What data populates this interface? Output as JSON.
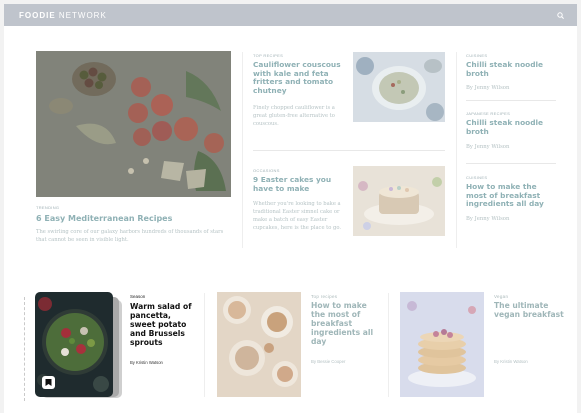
{
  "header": {
    "brand_bold": "FOODIE",
    "brand_light": " NETWORK",
    "search_icon": "search-icon"
  },
  "featured": {
    "kicker": "TRENDING",
    "title": "6 Easy Mediterranean Recipes",
    "excerpt": "The swirling core of our galaxy harbors hundreds of thousands of stars that cannot be seen in visible light."
  },
  "middle": [
    {
      "kicker": "TOP RECIPES",
      "title": "Cauliflower couscous with kale and feta fritters and tomato chutney",
      "excerpt": "Finely chopped cauliflower is a great gluten-free alternative to couscous."
    },
    {
      "kicker": "OCCASIONS",
      "title": "9 Easter cakes you have to make",
      "excerpt": "Whether you're looking to bake a traditional Easter simnel cake or make a batch of easy Easter cupcakes, here is the place to go."
    }
  ],
  "right": [
    {
      "kicker": "CUISINES",
      "title": "Chilli steak noodle broth",
      "byline": "By Jenny Wilson"
    },
    {
      "kicker": "JAPANESE RECIPES",
      "title": "Chilli steak noodle broth",
      "byline": "By Jenny Wilson"
    },
    {
      "kicker": "CUISINES",
      "title": "How to make the most of breakfast ingredients all day",
      "byline": "By Jenny Wilson"
    }
  ],
  "carousel": [
    {
      "kicker": "Season",
      "title": "Warm salad of pancetta, sweet potato and Brussels sprouts",
      "byline": "By Kristin Watson",
      "icon": "save-icon"
    },
    {
      "kicker": "Top recipes",
      "title": "How to make the most of breakfast ingredients all day",
      "byline": "By Bessie Cooper"
    },
    {
      "kicker": "Vegan",
      "title": "The ultimate vegan breakfast",
      "byline": "By Kristin Watson"
    }
  ]
}
